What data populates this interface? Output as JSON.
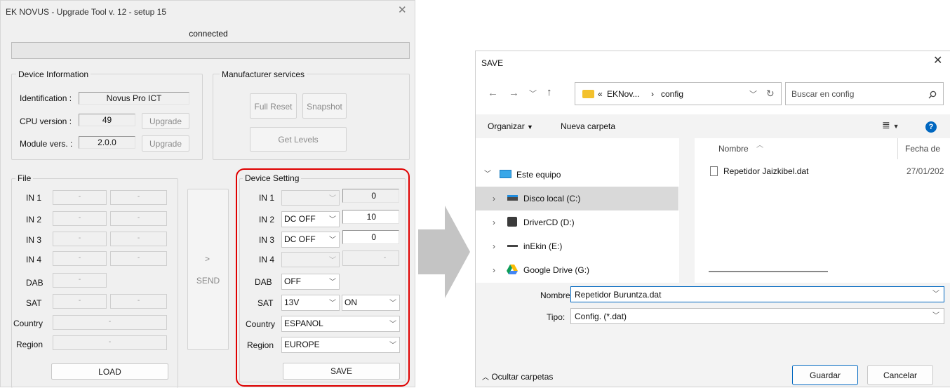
{
  "left_window": {
    "title": "EK NOVUS - Upgrade Tool v. 12 - setup 15",
    "close_glyph": "✕",
    "status": "connected",
    "device_info": {
      "title": "Device Information",
      "identification_label": "Identification :",
      "identification_value": "Novus Pro ICT",
      "cpu_label": "CPU version :",
      "cpu_value": "49",
      "module_label": "Module vers. :",
      "module_value": "2.0.0",
      "upgrade_label": "Upgrade"
    },
    "manufacturer": {
      "title": "Manufacturer services",
      "full_reset": "Full Reset",
      "snapshot": "Snapshot",
      "get_levels": "Get Levels"
    },
    "file_panel": {
      "title": "File",
      "rows": [
        "IN 1",
        "IN 2",
        "IN 3",
        "IN 4",
        "DAB",
        "SAT",
        "Country",
        "Region"
      ],
      "dash": "-",
      "load": "LOAD"
    },
    "send": {
      "arrow": ">",
      "label": "SEND"
    },
    "device_setting": {
      "title": "Device Setting",
      "rows": {
        "in1": {
          "label": "IN 1",
          "combo": "",
          "value": "0"
        },
        "in2": {
          "label": "IN 2",
          "combo": "DC OFF",
          "value": "10"
        },
        "in3": {
          "label": "IN 3",
          "combo": "DC OFF",
          "value": "0"
        },
        "in4": {
          "label": "IN 4",
          "combo": "",
          "value": "-"
        },
        "dab": {
          "label": "DAB",
          "combo": "OFF"
        },
        "sat": {
          "label": "SAT",
          "combo": "13V",
          "combo2": "ON"
        },
        "country": {
          "label": "Country",
          "combo": "ESPANOL"
        },
        "region": {
          "label": "Region",
          "combo": "EUROPE"
        }
      },
      "save": "SAVE",
      "highlight_color": "#e00000"
    }
  },
  "save_dialog": {
    "title": "SAVE",
    "close_glyph": "✕",
    "breadcrumb": {
      "prefix": "«",
      "folder1": "EKNov...",
      "sep": "›",
      "folder2": "config"
    },
    "search_placeholder": "Buscar en config",
    "organize": "Organizar",
    "new_folder": "Nueva carpeta",
    "tree": [
      {
        "label": "Este equipo",
        "icon": "computer-icon"
      },
      {
        "label": "Disco local (C:)",
        "icon": "drive-icon"
      },
      {
        "label": "DriverCD (D:)",
        "icon": "cd-drive-icon"
      },
      {
        "label": "inEkin (E:)",
        "icon": "usb-drive-icon"
      },
      {
        "label": "Google Drive (G:)",
        "icon": "google-drive-icon"
      }
    ],
    "columns": {
      "name": "Nombre",
      "date": "Fecha de"
    },
    "files": [
      {
        "name": "Repetidor Jaizkibel.dat",
        "date": "27/01/202"
      }
    ],
    "filename_label": "Nombre:",
    "filename_value": "Repetidor Buruntza.dat",
    "type_label": "Tipo:",
    "type_value": "Config. (*.dat)",
    "hide_folders": "Ocultar carpetas",
    "save_button": "Guardar",
    "cancel_button": "Cancelar",
    "accent_color": "#0067c0"
  }
}
